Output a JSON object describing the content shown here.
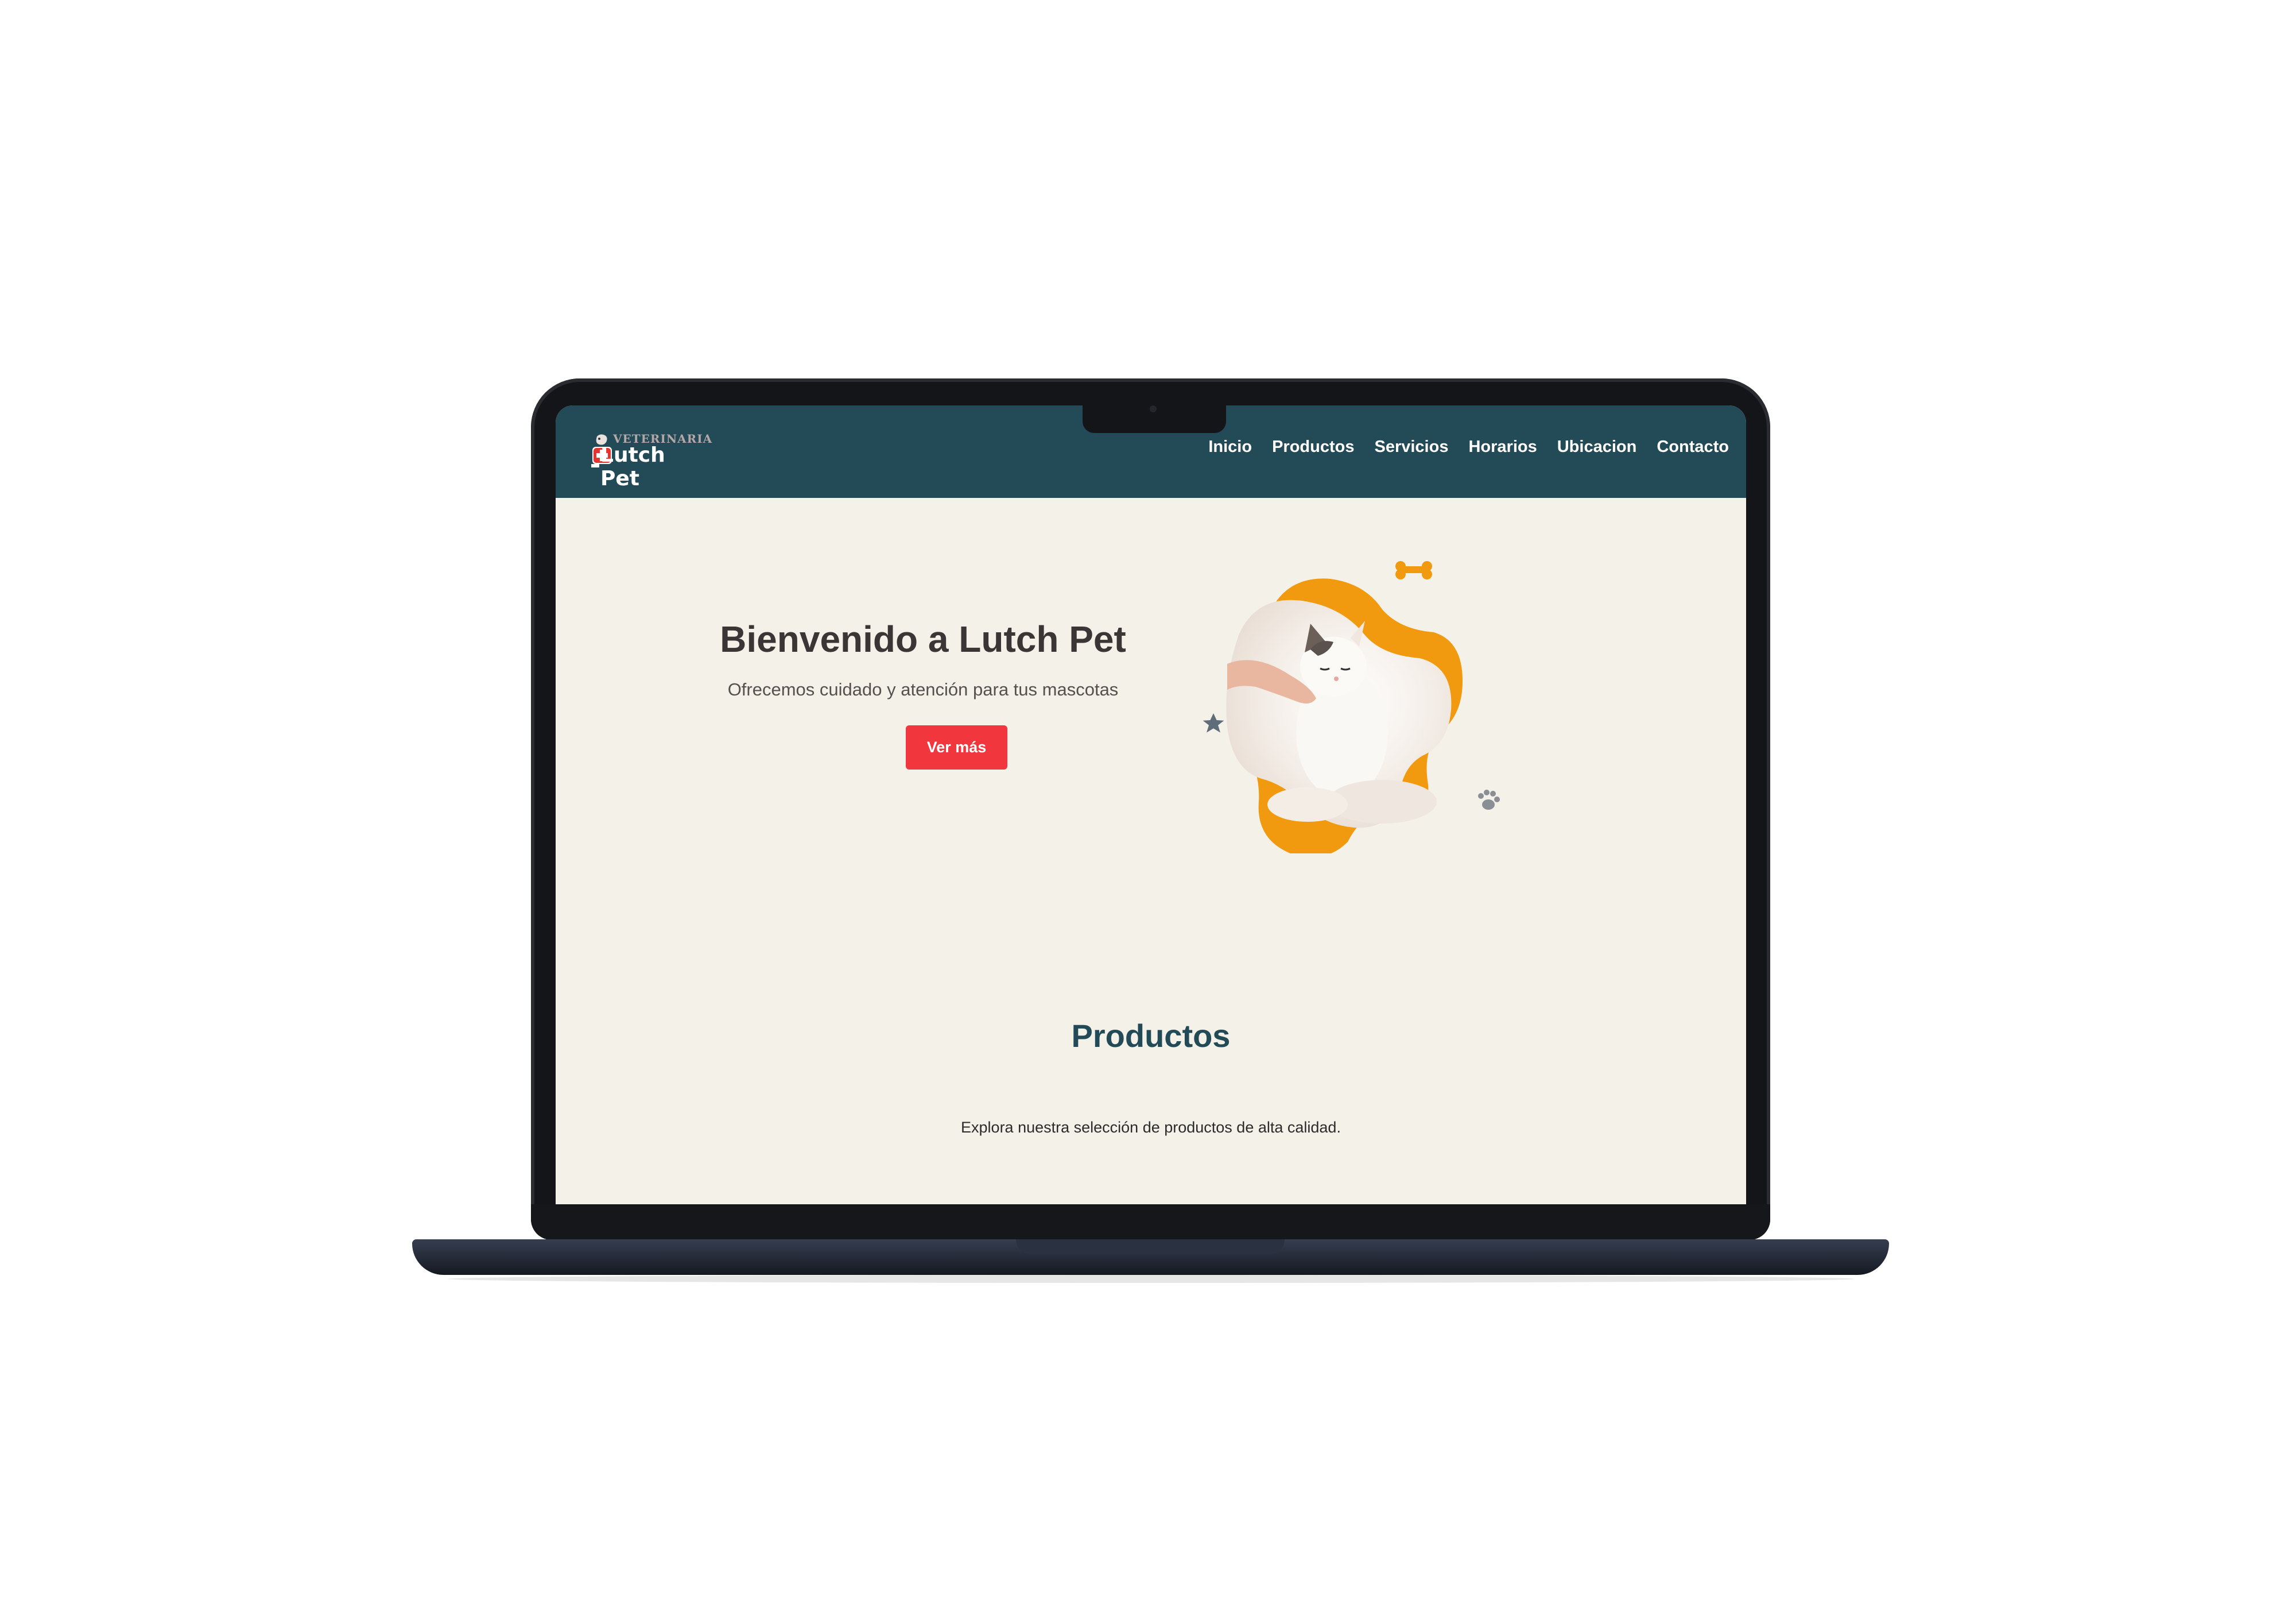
{
  "brand": {
    "logo_top": "VETERINARIA",
    "logo_main": "Lutch Pet"
  },
  "nav": {
    "items": [
      {
        "label": "Inicio"
      },
      {
        "label": "Productos"
      },
      {
        "label": "Servicios"
      },
      {
        "label": "Horarios"
      },
      {
        "label": "Ubicacion"
      },
      {
        "label": "Contacto"
      }
    ]
  },
  "hero": {
    "title": "Bienvenido a Lutch Pet",
    "subtitle": "Ofrecemos cuidado y atención para tus mascotas",
    "button_label": "Ver más",
    "image_icon": "cat-photo"
  },
  "products": {
    "title": "Productos",
    "subtitle": "Explora nuestra selección de productos de alta calidad."
  },
  "colors": {
    "navbar": "#234b57",
    "page_bg": "#f4f1e9",
    "accent_button": "#f1363d",
    "blob_orange": "#f29a0f",
    "products_title": "#234b57"
  }
}
